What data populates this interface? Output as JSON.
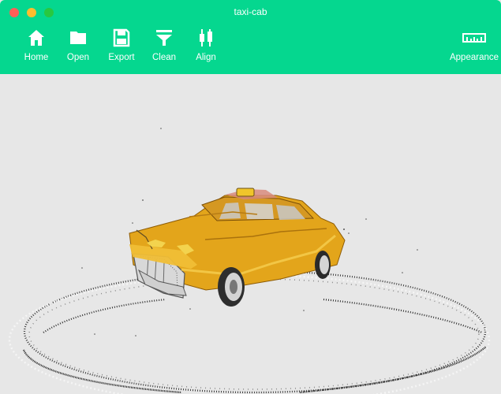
{
  "window": {
    "title": "taxi-cab"
  },
  "toolbar": {
    "home": {
      "label": "Home",
      "icon": "home-icon"
    },
    "open": {
      "label": "Open",
      "icon": "folder-icon"
    },
    "export": {
      "label": "Export",
      "icon": "floppy-disk-icon"
    },
    "clean": {
      "label": "Clean",
      "icon": "funnel-icon"
    },
    "align": {
      "label": "Align",
      "icon": "align-icon"
    },
    "appearance": {
      "label": "Appearance",
      "icon": "ruler-icon"
    }
  },
  "colors": {
    "accent": "#05d78f",
    "background": "#e7e7e7",
    "close": "#fe5f57",
    "minimize": "#febc2e",
    "maximize": "#28c840",
    "taxi_yellow": "#e3a51b"
  }
}
